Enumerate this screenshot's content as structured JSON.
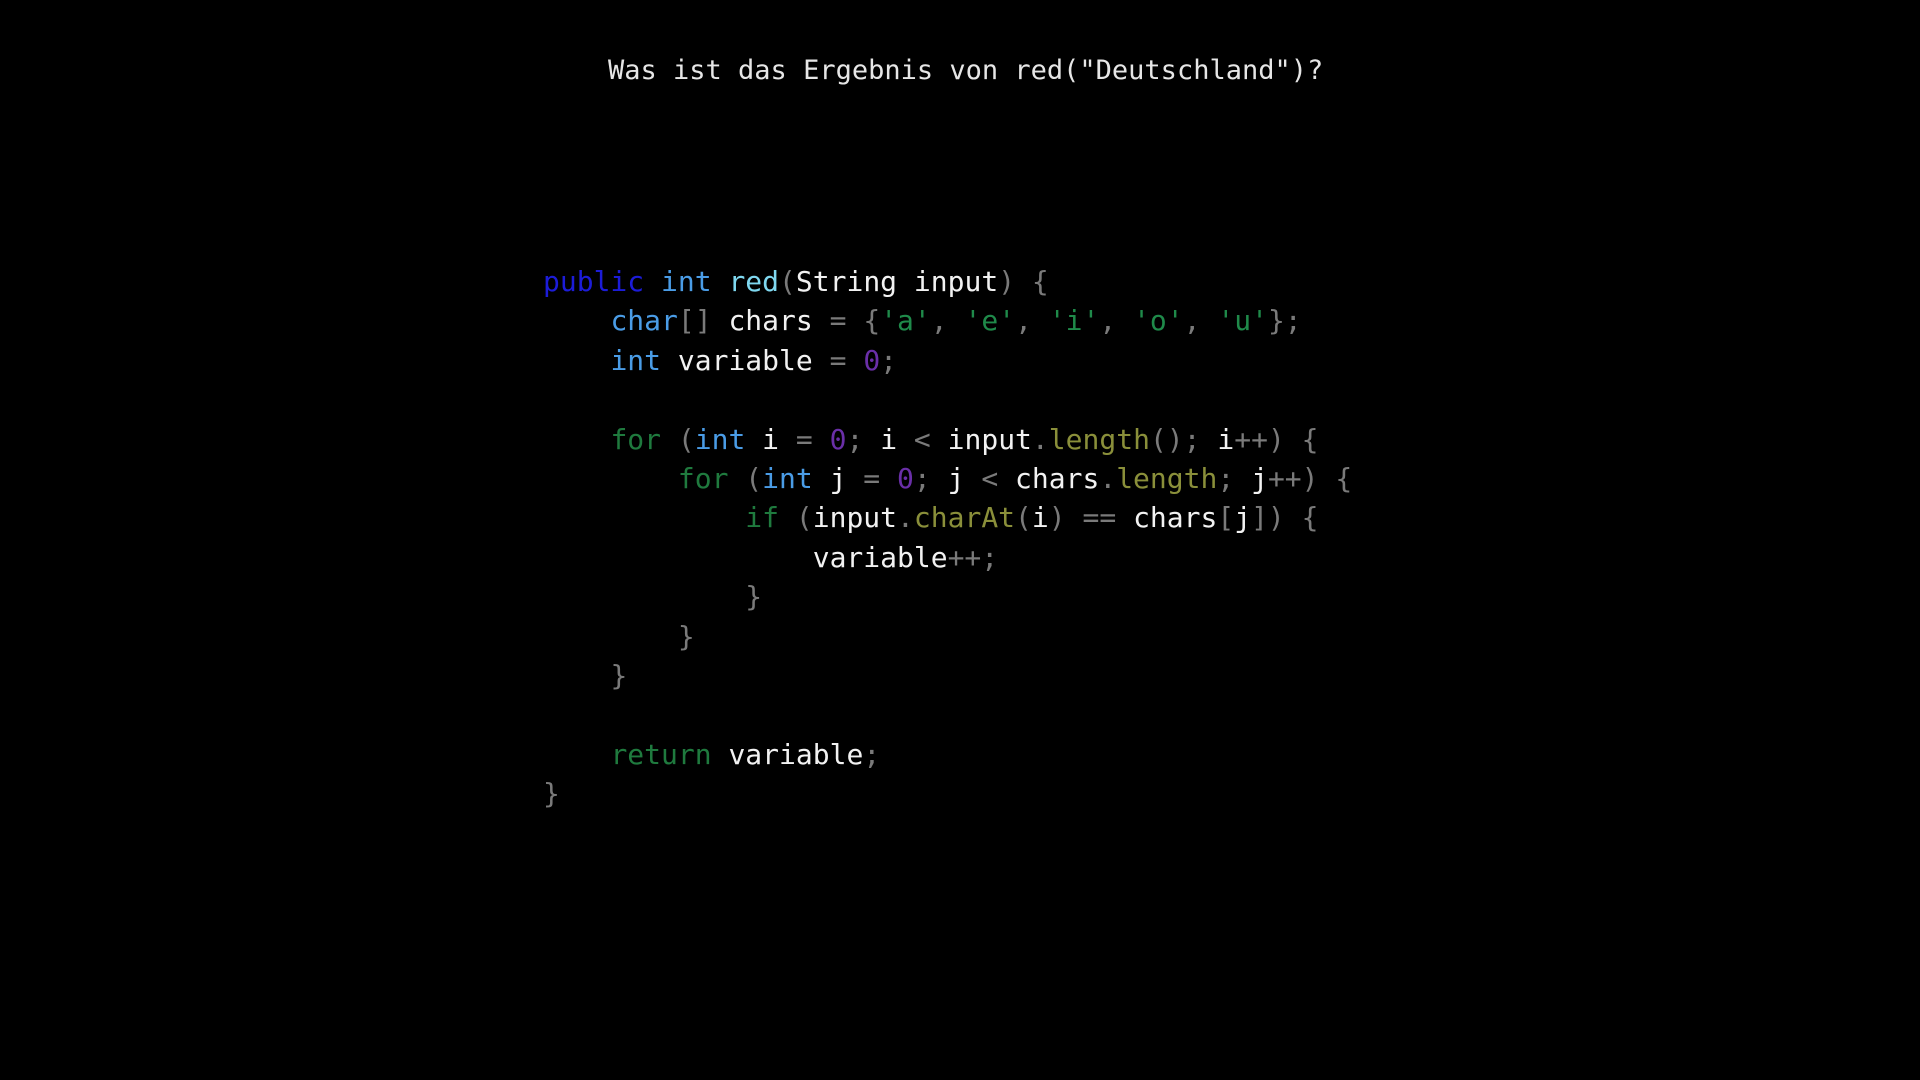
{
  "question": "Was ist das Ergebnis von red(\"Deutschland\")?",
  "colors": {
    "background": "#000000",
    "access_keyword": "#1c1cd8",
    "type": "#4a9ce6",
    "method_definition": "#7fd8f0",
    "identifier": "#f2f2f2",
    "punctuation": "#7a7a7a",
    "string": "#1f8a4a",
    "number": "#6a2fa8",
    "control_keyword": "#1f7a3e",
    "method_call": "#8a8f3a"
  },
  "code": {
    "language": "java",
    "lines": [
      [
        [
          "public",
          "kw-access"
        ],
        [
          " ",
          "ident"
        ],
        [
          "int",
          "type"
        ],
        [
          " ",
          "ident"
        ],
        [
          "red",
          "method-def"
        ],
        [
          "(",
          "punct"
        ],
        [
          "String",
          "ident"
        ],
        [
          " ",
          "ident"
        ],
        [
          "input",
          "ident"
        ],
        [
          ")",
          "punct"
        ],
        [
          " ",
          "ident"
        ],
        [
          "{",
          "punct"
        ]
      ],
      [
        [
          "    ",
          "ident"
        ],
        [
          "char",
          "type"
        ],
        [
          "[]",
          "punct"
        ],
        [
          " ",
          "ident"
        ],
        [
          "chars",
          "ident"
        ],
        [
          " = ",
          "punct"
        ],
        [
          "{",
          "punct"
        ],
        [
          "'a'",
          "string"
        ],
        [
          ", ",
          "punct"
        ],
        [
          "'e'",
          "string"
        ],
        [
          ", ",
          "punct"
        ],
        [
          "'i'",
          "string"
        ],
        [
          ", ",
          "punct"
        ],
        [
          "'o'",
          "string"
        ],
        [
          ", ",
          "punct"
        ],
        [
          "'u'",
          "string"
        ],
        [
          "};",
          "punct"
        ]
      ],
      [
        [
          "    ",
          "ident"
        ],
        [
          "int",
          "type"
        ],
        [
          " ",
          "ident"
        ],
        [
          "variable",
          "ident"
        ],
        [
          " = ",
          "punct"
        ],
        [
          "0",
          "number"
        ],
        [
          ";",
          "punct"
        ]
      ],
      [],
      [
        [
          "    ",
          "ident"
        ],
        [
          "for",
          "control"
        ],
        [
          " (",
          "punct"
        ],
        [
          "int",
          "type"
        ],
        [
          " ",
          "ident"
        ],
        [
          "i",
          "ident"
        ],
        [
          " = ",
          "punct"
        ],
        [
          "0",
          "number"
        ],
        [
          "; ",
          "punct"
        ],
        [
          "i",
          "ident"
        ],
        [
          " < ",
          "punct"
        ],
        [
          "input",
          "ident"
        ],
        [
          ".",
          "punct"
        ],
        [
          "length",
          "method"
        ],
        [
          "(); ",
          "punct"
        ],
        [
          "i",
          "ident"
        ],
        [
          "++) {",
          "punct"
        ]
      ],
      [
        [
          "        ",
          "ident"
        ],
        [
          "for",
          "control"
        ],
        [
          " (",
          "punct"
        ],
        [
          "int",
          "type"
        ],
        [
          " ",
          "ident"
        ],
        [
          "j",
          "ident"
        ],
        [
          " = ",
          "punct"
        ],
        [
          "0",
          "number"
        ],
        [
          "; ",
          "punct"
        ],
        [
          "j",
          "ident"
        ],
        [
          " < ",
          "punct"
        ],
        [
          "chars",
          "ident"
        ],
        [
          ".",
          "punct"
        ],
        [
          "length",
          "method"
        ],
        [
          "; ",
          "punct"
        ],
        [
          "j",
          "ident"
        ],
        [
          "++) {",
          "punct"
        ]
      ],
      [
        [
          "            ",
          "ident"
        ],
        [
          "if",
          "control"
        ],
        [
          " (",
          "punct"
        ],
        [
          "input",
          "ident"
        ],
        [
          ".",
          "punct"
        ],
        [
          "charAt",
          "method"
        ],
        [
          "(",
          "punct"
        ],
        [
          "i",
          "ident"
        ],
        [
          ") == ",
          "punct"
        ],
        [
          "chars",
          "ident"
        ],
        [
          "[",
          "punct"
        ],
        [
          "j",
          "ident"
        ],
        [
          "]) {",
          "punct"
        ]
      ],
      [
        [
          "                ",
          "ident"
        ],
        [
          "variable",
          "ident"
        ],
        [
          "++;",
          "punct"
        ]
      ],
      [
        [
          "            ",
          "ident"
        ],
        [
          "}",
          "punct"
        ]
      ],
      [
        [
          "        ",
          "ident"
        ],
        [
          "}",
          "punct"
        ]
      ],
      [
        [
          "    ",
          "ident"
        ],
        [
          "}",
          "punct"
        ]
      ],
      [],
      [
        [
          "    ",
          "ident"
        ],
        [
          "return",
          "control"
        ],
        [
          " ",
          "ident"
        ],
        [
          "variable",
          "ident"
        ],
        [
          ";",
          "punct"
        ]
      ],
      [
        [
          "}",
          "punct"
        ]
      ]
    ]
  }
}
